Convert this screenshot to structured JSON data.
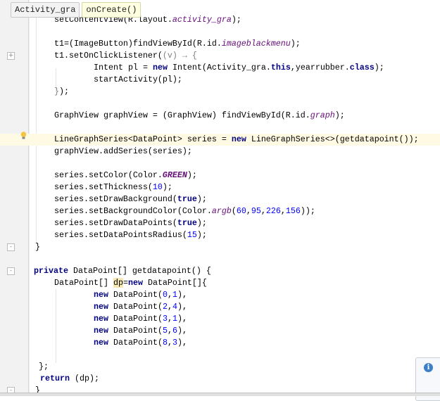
{
  "breadcrumb": {
    "class_name": "Activity_gra",
    "method_name": "onCreate()"
  },
  "code_lines": [
    [
      [
        "setContentView(R.layout.",
        ""
      ],
      [
        "activity_gra",
        "field"
      ],
      [
        ");",
        ""
      ]
    ],
    [],
    [
      [
        "t1=(ImageButton)findViewById(R.id.",
        ""
      ],
      [
        "imageblackmenu",
        "field"
      ],
      [
        ");",
        ""
      ]
    ],
    [
      [
        "t1.setOnClickListener(",
        ""
      ],
      [
        "(v) → {",
        "lam"
      ]
    ],
    [
      [
        "Intent pl = ",
        ""
      ],
      [
        "new",
        "kw"
      ],
      [
        " Intent(Activity_gra.",
        ""
      ],
      [
        "this",
        "kw"
      ],
      [
        ",yearrubber.",
        ""
      ],
      [
        "class",
        "kw"
      ],
      [
        ");",
        ""
      ]
    ],
    [
      [
        "startActivity(pl);",
        ""
      ]
    ],
    [
      [
        "}",
        "lam"
      ],
      [
        ");",
        ""
      ]
    ],
    [],
    [
      [
        "GraphView graphView = (GraphView) findViewById(R.id.",
        ""
      ],
      [
        "graph",
        "field"
      ],
      [
        ");",
        ""
      ]
    ],
    [],
    [
      [
        "LineGraphSeries<DataPoint> series = ",
        ""
      ],
      [
        "new",
        "kw"
      ],
      [
        " LineGraphSeries<>(getdatapoint());",
        ""
      ]
    ],
    [
      [
        "graphView.addSeries(series);",
        ""
      ]
    ],
    [],
    [
      [
        "series.setColor(Color.",
        ""
      ],
      [
        "GREEN",
        "const"
      ],
      [
        ");",
        ""
      ]
    ],
    [
      [
        "series.setThickness(",
        ""
      ],
      [
        "10",
        "num"
      ],
      [
        ");",
        ""
      ]
    ],
    [
      [
        "series.setDrawBackground(",
        ""
      ],
      [
        "true",
        "kw"
      ],
      [
        ");",
        ""
      ]
    ],
    [
      [
        "series.setBackgroundColor(Color.",
        ""
      ],
      [
        "argb",
        "field"
      ],
      [
        "(",
        ""
      ],
      [
        "60",
        "num"
      ],
      [
        ",",
        ""
      ],
      [
        "95",
        "num"
      ],
      [
        ",",
        ""
      ],
      [
        "226",
        "num"
      ],
      [
        ",",
        ""
      ],
      [
        "156",
        "num"
      ],
      [
        "));",
        ""
      ]
    ],
    [
      [
        "series.setDrawDataPoints(",
        ""
      ],
      [
        "true",
        "kw"
      ],
      [
        ");",
        ""
      ]
    ],
    [
      [
        "series.setDataPointsRadius(",
        ""
      ],
      [
        "15",
        "num"
      ],
      [
        ");",
        ""
      ]
    ],
    [
      [
        "}",
        ""
      ]
    ],
    [],
    [
      [
        "private",
        "kw"
      ],
      [
        " DataPoint[] getdatapoint() {",
        ""
      ]
    ],
    [
      [
        "DataPoint[] ",
        ""
      ],
      [
        "dp",
        "var"
      ],
      [
        "=",
        ""
      ],
      [
        "new",
        "kw"
      ],
      [
        " DataPoint[]{",
        ""
      ]
    ],
    [
      [
        "new",
        "kw"
      ],
      [
        " DataPoint(",
        ""
      ],
      [
        "0",
        "num"
      ],
      [
        ",",
        ""
      ],
      [
        "1",
        "num"
      ],
      [
        "),",
        ""
      ]
    ],
    [
      [
        "new",
        "kw"
      ],
      [
        " DataPoint(",
        ""
      ],
      [
        "2",
        "num"
      ],
      [
        ",",
        ""
      ],
      [
        "4",
        "num"
      ],
      [
        "),",
        ""
      ]
    ],
    [
      [
        "new",
        "kw"
      ],
      [
        " DataPoint(",
        ""
      ],
      [
        "3",
        "num"
      ],
      [
        ",",
        ""
      ],
      [
        "1",
        "num"
      ],
      [
        "),",
        ""
      ]
    ],
    [
      [
        "new",
        "kw"
      ],
      [
        " DataPoint(",
        ""
      ],
      [
        "5",
        "num"
      ],
      [
        ",",
        ""
      ],
      [
        "6",
        "num"
      ],
      [
        "),",
        ""
      ]
    ],
    [
      [
        "new",
        "kw"
      ],
      [
        " DataPoint(",
        ""
      ],
      [
        "8",
        "num"
      ],
      [
        ",",
        ""
      ],
      [
        "3",
        "num"
      ],
      [
        "),",
        ""
      ]
    ],
    [],
    [
      [
        "};",
        ""
      ]
    ],
    [
      [
        "return",
        "kw"
      ],
      [
        " (dp);",
        ""
      ]
    ],
    [
      [
        "}",
        ""
      ]
    ]
  ],
  "notification": {
    "icon": "info-icon"
  },
  "colors": {
    "keyword": "#000080",
    "number": "#0000ff",
    "constant": "#660e7a",
    "highlight_line": "#fffae3"
  }
}
